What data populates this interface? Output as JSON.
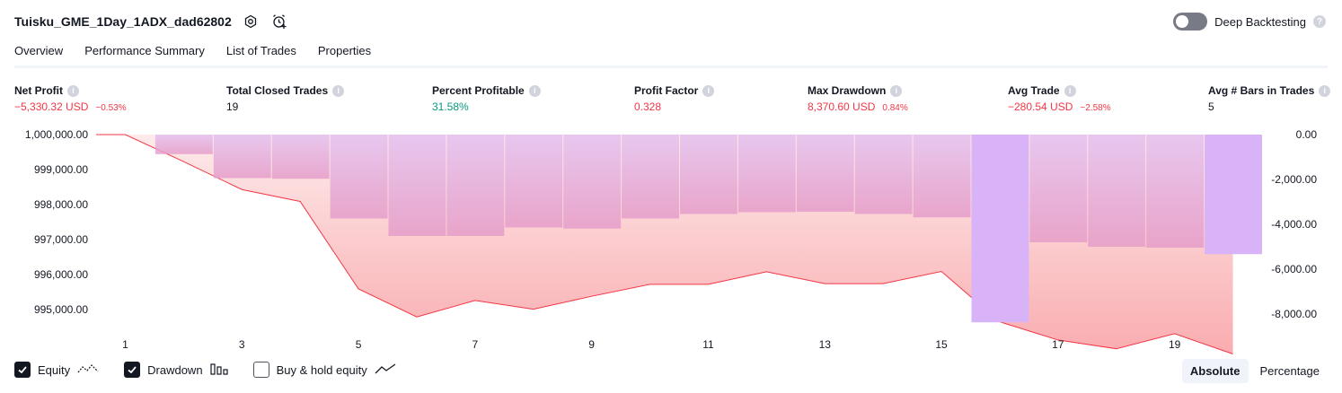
{
  "header": {
    "title": "Tuisku_GME_1Day_1ADX_dad62802",
    "deep_backtesting_label": "Deep Backtesting"
  },
  "tabs": [
    {
      "label": "Overview"
    },
    {
      "label": "Performance Summary"
    },
    {
      "label": "List of Trades"
    },
    {
      "label": "Properties"
    }
  ],
  "metrics": {
    "net_profit": {
      "label": "Net Profit",
      "value": "−5,330.32 USD",
      "pct": "−0.53%"
    },
    "total_closed_trades": {
      "label": "Total Closed Trades",
      "value": "19"
    },
    "percent_profitable": {
      "label": "Percent Profitable",
      "value": "31.58%"
    },
    "profit_factor": {
      "label": "Profit Factor",
      "value": "0.328"
    },
    "max_drawdown": {
      "label": "Max Drawdown",
      "value": "8,370.60 USD",
      "pct": "0.84%"
    },
    "avg_trade": {
      "label": "Avg Trade",
      "value": "−280.54 USD",
      "pct": "−2.58%"
    },
    "avg_bars": {
      "label": "Avg # Bars in Trades",
      "value": "5"
    }
  },
  "colors": {
    "equity_line": "#f23645",
    "equity_fill_top": "#fde0e0",
    "equity_fill_bottom": "#f9a3a7",
    "drawdown_bar_top": "#e2bff0",
    "drawdown_bar_bottom": "#e59bc9",
    "drawdown_bar_extreme": "#d8b3f7",
    "axis_text": "#131722"
  },
  "chart_data": {
    "type": "line",
    "x_ticks": [
      "1",
      "3",
      "5",
      "7",
      "9",
      "11",
      "13",
      "15",
      "17",
      "19"
    ],
    "left_axis_ticks": [
      "1,000,000.00",
      "999,000.00",
      "998,000.00",
      "997,000.00",
      "996,000.00",
      "995,000.00"
    ],
    "right_axis_ticks": [
      "0.00",
      "-2,000.00",
      "-4,000.00",
      "-6,000.00",
      "-8,000.00"
    ],
    "ylim_left": [
      994500,
      1000000
    ],
    "ylim_right": [
      -8500,
      0
    ],
    "series": [
      {
        "name": "Equity",
        "axis": "left",
        "x": [
          0.5,
          1,
          2,
          3,
          4,
          5,
          6,
          7,
          8,
          9,
          10,
          11,
          12,
          13,
          14,
          15,
          16,
          17,
          18,
          19,
          20
        ],
        "values": [
          1000000,
          1000000,
          999230,
          998430,
          998090,
          995590,
          994790,
          995260,
          995010,
          995380,
          995720,
          995720,
          996080,
          995740,
          995740,
          996090,
          994650,
          994130,
          993880,
          994310,
          993730
        ]
      },
      {
        "name": "Drawdown",
        "axis": "right",
        "x": [
          1,
          2,
          3,
          4,
          5,
          6,
          7,
          8,
          9,
          10,
          11,
          12,
          13,
          14,
          15,
          16,
          17,
          18,
          19,
          20
        ],
        "values": [
          0,
          -870,
          -1940,
          -1970,
          -3740,
          -4520,
          -4520,
          -4140,
          -4190,
          -3740,
          -3540,
          -3460,
          -3440,
          -3540,
          -3690,
          -8370,
          -4800,
          -5000,
          -5040,
          -5330
        ]
      }
    ],
    "grid": false
  },
  "legend": {
    "equity": {
      "label": "Equity",
      "checked": true
    },
    "drawdown": {
      "label": "Drawdown",
      "checked": true
    },
    "buy_hold": {
      "label": "Buy & hold equity",
      "checked": false
    }
  },
  "mode": {
    "absolute": "Absolute",
    "percentage": "Percentage"
  }
}
